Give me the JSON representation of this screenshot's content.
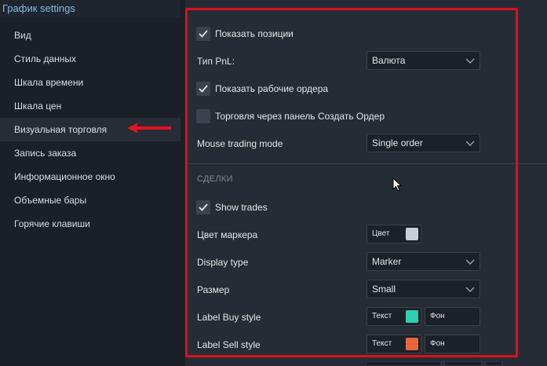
{
  "window": {
    "title": "График settings"
  },
  "sidebar": {
    "items": [
      {
        "label": "Вид"
      },
      {
        "label": "Стиль данных"
      },
      {
        "label": "Шкала времени"
      },
      {
        "label": "Шкала цен"
      },
      {
        "label": "Визуальная торговля",
        "active": true
      },
      {
        "label": "Запись заказа"
      },
      {
        "label": "Информационное окно"
      },
      {
        "label": "Объемные бары"
      },
      {
        "label": "Горячие клавиши"
      }
    ]
  },
  "settings": {
    "show_positions": {
      "label": "Показать позиции",
      "checked": true
    },
    "pnl_type": {
      "label": "Тип PnL:",
      "value": "Валюта"
    },
    "show_working_orders": {
      "label": "Показать рабочие ордера",
      "checked": true
    },
    "trade_via_panel": {
      "label": "Торговля через панель Создать Ордер",
      "checked": false
    },
    "mouse_trading_mode": {
      "label": "Mouse trading mode",
      "value": "Single order"
    }
  },
  "trades_section": {
    "title": "СДЕЛКИ",
    "show_trades": {
      "label": "Show trades",
      "checked": true
    },
    "marker_color": {
      "label": "Цвет маркера",
      "button_label": "Цвет",
      "color": "#c9cfd8"
    },
    "display_type": {
      "label": "Display type",
      "value": "Marker"
    },
    "size": {
      "label": "Размер",
      "value": "Small"
    },
    "label_buy_style": {
      "label": "Label Buy style",
      "text_label": "Текст",
      "text_color": "#2fd0b0",
      "bg_label": "Фон"
    },
    "label_sell_style": {
      "label": "Label Sell style",
      "text_label": "Текст",
      "text_color": "#e8653a",
      "bg_label": "Фон"
    }
  },
  "colors": {
    "accent": "#7fbbe8",
    "highlight": "#d8121b",
    "panel": "#262c35",
    "sidebar": "#1b2028"
  }
}
